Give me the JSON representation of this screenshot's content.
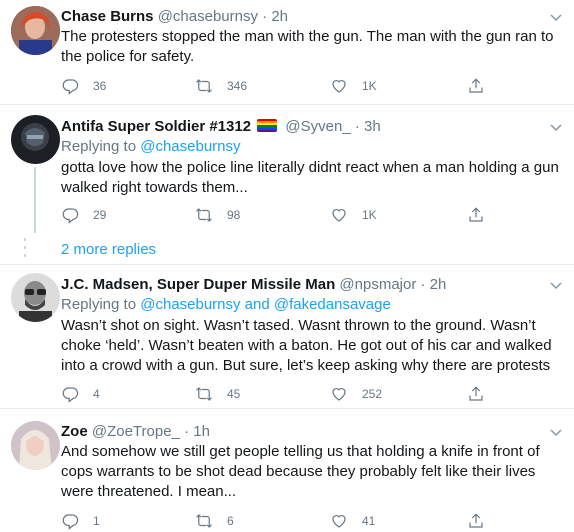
{
  "tweets": [
    {
      "name": "Chase Burns",
      "handle": "@chaseburnsy",
      "time": "2h",
      "body": "The protesters stopped the man with the gun. The man with the gun ran to the police for safety.",
      "reply_count": "36",
      "retweet_count": "346",
      "like_count": "1K"
    },
    {
      "name": "Antifa Super Soldier #1312",
      "handle": "@Syven_",
      "time": "3h",
      "replying_prefix": "Replying to",
      "replying_to": "@chaseburnsy",
      "body": "gotta love how the police line literally didnt react when a man holding a gun walked right towards them...",
      "reply_count": "29",
      "retweet_count": "98",
      "like_count": "1K"
    },
    {
      "name": "J.C. Madsen, Super Duper Missile Man",
      "handle": "@npsmajor",
      "time": "2h",
      "replying_prefix": "Replying to",
      "replying_to": "@chaseburnsy and @fakedansavage",
      "body": "Wasn’t shot on sight. Wasn’t tased.  Wasnt thrown to the ground. Wasn’t choke ‘held’. Wasn’t beaten with a baton. He got out of his car and walked into a crowd with a gun. But sure, let’s keep asking why there are protests",
      "reply_count": "4",
      "retweet_count": "45",
      "like_count": "252"
    },
    {
      "name": "Zoe",
      "handle": "@ZoeTrope_",
      "time": "1h",
      "body": "And somehow we still get people telling us that holding a knife in front of cops warrants to be shot dead because they probably felt like their lives were threatened. I mean...",
      "reply_count": "1",
      "retweet_count": "6",
      "like_count": "41"
    }
  ],
  "more_replies_label": "2 more replies",
  "separator": "·",
  "colors": {
    "link": "#1da1f2",
    "secondary_text": "#657786",
    "divider": "#e6ecf0",
    "thread_line": "#ccd6dd"
  },
  "icons": [
    "reply-icon",
    "retweet-icon",
    "like-icon",
    "share-icon",
    "more-chevron-icon",
    "rainbow-flag-icon"
  ]
}
